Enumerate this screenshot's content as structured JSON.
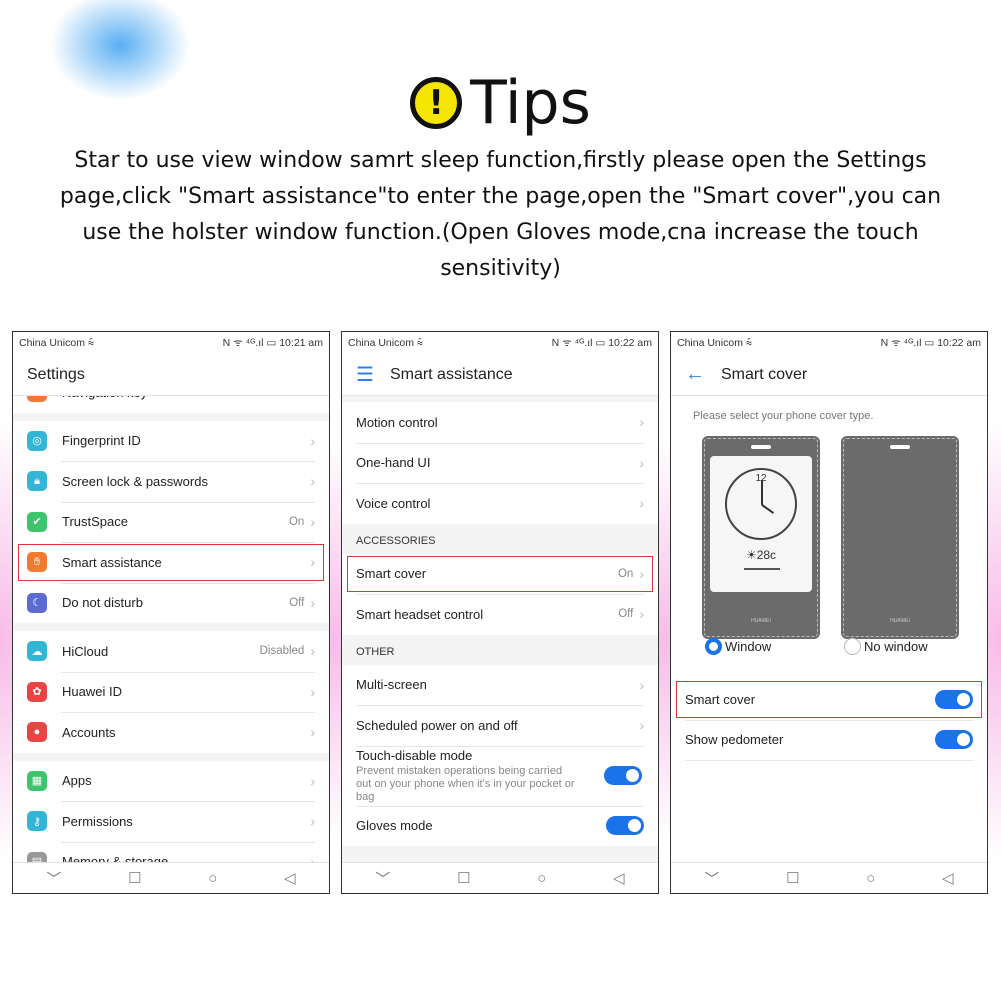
{
  "tips": {
    "icon": "exclamation-icon",
    "title": "Tips",
    "description": "Star to use view window samrt sleep function,firstly please open the Settings page,click \"Smart assistance\"to enter the page,open the \"Smart cover\",you can use the holster window function.(Open Gloves mode,cna increase the touch sensitivity)"
  },
  "colors": {
    "accent": "#1a73e8",
    "highlight": "#e33333"
  },
  "phones": [
    {
      "carrier": "China Unicom",
      "time": "10:21 am",
      "title": "Settings",
      "groups": [
        [
          {
            "label": "Navigation key",
            "icon": "keyboard-icon",
            "color": "#f07a30"
          }
        ],
        [
          {
            "label": "Fingerprint ID",
            "icon": "fingerprint-icon",
            "color": "#33b5d6"
          },
          {
            "label": "Screen lock & passwords",
            "icon": "lock-icon",
            "color": "#33b5d6"
          },
          {
            "label": "TrustSpace",
            "icon": "shield-icon",
            "color": "#3ec46d",
            "value": "On"
          },
          {
            "label": "Smart assistance",
            "icon": "hand-icon",
            "color": "#f07a30",
            "highlight": true
          },
          {
            "label": "Do not disturb",
            "icon": "moon-icon",
            "color": "#5b6bd1",
            "value": "Off"
          }
        ],
        [
          {
            "label": "HiCloud",
            "icon": "cloud-icon",
            "color": "#33b5d6",
            "value": "Disabled"
          },
          {
            "label": "Huawei ID",
            "icon": "huawei-icon",
            "color": "#e84545"
          },
          {
            "label": "Accounts",
            "icon": "user-icon",
            "color": "#e84545"
          }
        ],
        [
          {
            "label": "Apps",
            "icon": "apps-icon",
            "color": "#3ec46d"
          },
          {
            "label": "Permissions",
            "icon": "key-icon",
            "color": "#33b5d6"
          },
          {
            "label": "Memory & storage",
            "icon": "storage-icon",
            "color": "#999999"
          }
        ]
      ]
    },
    {
      "carrier": "China Unicom",
      "time": "10:22 am",
      "title": "Smart assistance",
      "header_icon": "menu-icon",
      "sections": [
        {
          "header": "",
          "items": [
            {
              "label": "Motion control"
            },
            {
              "label": "One-hand UI"
            },
            {
              "label": "Voice control"
            }
          ]
        },
        {
          "header": "ACCESSORIES",
          "items": [
            {
              "label": "Smart cover",
              "value": "On",
              "highlight": true
            },
            {
              "label": "Smart headset control",
              "value": "Off"
            }
          ]
        },
        {
          "header": "OTHER",
          "items": [
            {
              "label": "Multi-screen"
            },
            {
              "label": "Scheduled power on and off"
            },
            {
              "label": "Touch-disable mode",
              "sub": "Prevent mistaken operations being carried out on your phone when it's in your pocket or bag",
              "toggle": true
            },
            {
              "label": "Gloves mode",
              "toggle": true
            }
          ]
        }
      ]
    },
    {
      "carrier": "China Unicom",
      "time": "10:22 am",
      "title": "Smart cover",
      "header_icon": "back-arrow-icon",
      "prompt": "Please select your phone cover type.",
      "cover_brand": "HUAWEI",
      "clock_number": "12",
      "temperature": "28c",
      "options": [
        {
          "label": "Window",
          "selected": true
        },
        {
          "label": "No window",
          "selected": false
        }
      ],
      "items": [
        {
          "label": "Smart cover",
          "toggle": true,
          "highlight": true
        },
        {
          "label": "Show pedometer",
          "toggle": true
        }
      ]
    }
  ],
  "status_icons": "N ᯤ ⁴ᴳ.ıl ▭",
  "nav": {
    "down": "﹀",
    "recent": "☐",
    "home": "○",
    "back": "◁"
  }
}
